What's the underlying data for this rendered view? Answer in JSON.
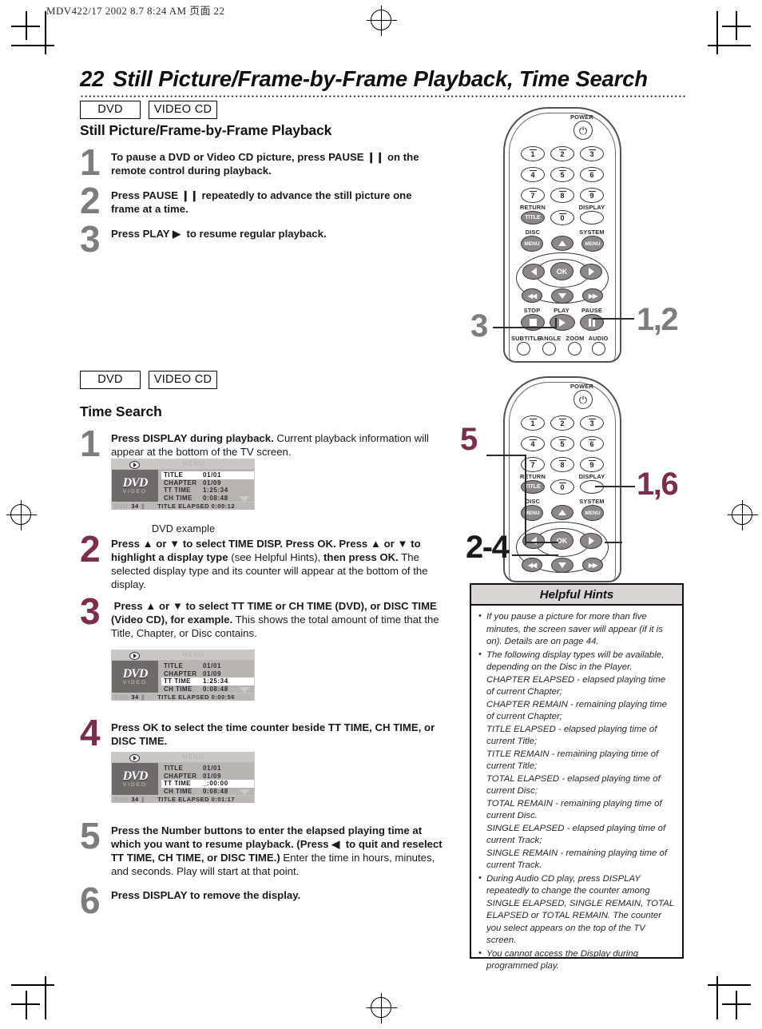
{
  "print_header": "MDV422/17  2002 8.7  8:24 AM  页面 22",
  "page": {
    "number": "22",
    "title": "Still Picture/Frame-by-Frame Playback, Time Search"
  },
  "section1": {
    "badges": [
      "DVD",
      "VIDEO CD"
    ],
    "heading": "Still Picture/Frame-by-Frame Playback",
    "steps": [
      {
        "n": "1",
        "color": "gray",
        "html": "<b>To pause a DVD or Video CD picture, press PAUSE ❙❙ on the remote control during playback.</b>"
      },
      {
        "n": "2",
        "color": "gray",
        "html": "<b>Press PAUSE ❙❙ repeatedly to advance the still picture one frame at a time.</b>"
      },
      {
        "n": "3",
        "color": "gray",
        "html": "<b>Press PLAY ▶ &nbsp;to resume regular playback.</b>"
      }
    ]
  },
  "section2": {
    "badges": [
      "DVD",
      "VIDEO CD"
    ],
    "heading": "Time Search",
    "steps": [
      {
        "n": "1",
        "color": "gray",
        "html": "<b>Press DISPLAY during playback.</b> Current playback information will appear at the bottom of the TV screen."
      },
      {
        "n": "2",
        "color": "maroon",
        "html": "<b>Press ▲ or ▼ to select TIME DISP. Press OK. Press ▲ or ▼ to highlight a display type</b> (see Helpful Hints), <b>then press OK.</b> The selected display type and its counter will appear at the bottom of the display."
      },
      {
        "n": "3",
        "color": "maroon",
        "html": "<b>&nbsp;Press ▲ or ▼ to select TT TIME or CH TIME (DVD), or DISC TIME (Video CD), for example.</b> This shows the total amount of time that the Title, Chapter, or Disc contains."
      },
      {
        "n": "4",
        "color": "maroon",
        "html": "<b>Press OK to select the time counter beside TT TIME, CH TIME, or DISC TIME.</b>"
      },
      {
        "n": "5",
        "color": "gray",
        "html": "<b>Press the Number buttons to enter the elapsed playing time at which you want to resume playback. (Press ◀ &nbsp;to quit and reselect TT TIME, CH TIME, or DISC TIME.)</b> Enter the time in hours, minutes, and seconds. Play will start at that point."
      },
      {
        "n": "6",
        "color": "gray",
        "html": "<b>Press DISPLAY to remove the display.</b>"
      }
    ],
    "osd_caption": "DVD example"
  },
  "osd_screens": [
    {
      "menu_word": "MENU",
      "logo_top": "DVD",
      "logo_bottom": "VIDEO",
      "rows": [
        {
          "label": "TITLE",
          "value": "01/01",
          "highlight": true
        },
        {
          "label": "CHAPTER",
          "value": "01/09",
          "highlight": false
        },
        {
          "label": "TT  TIME",
          "value": "1:25:34",
          "highlight": false
        },
        {
          "label": "CH  TIME",
          "value": "0:08:48",
          "highlight": false
        }
      ],
      "disc_label": "DVD",
      "page_num": "34",
      "counter_label": "TITLE  ELAPSED",
      "counter_value": "0:00:12"
    },
    {
      "menu_word": "MENU",
      "logo_top": "DVD",
      "logo_bottom": "VIDEO",
      "rows": [
        {
          "label": "TITLE",
          "value": "01/01",
          "highlight": false
        },
        {
          "label": "CHAPTER",
          "value": "01/09",
          "highlight": false
        },
        {
          "label": "TT  TIME",
          "value": "1:25:34",
          "highlight": true
        },
        {
          "label": "CH  TIME",
          "value": "0:08:48",
          "highlight": false
        }
      ],
      "disc_label": "DVD",
      "page_num": "34",
      "counter_label": "TITLE  ELAPSED",
      "counter_value": "0:00:56"
    },
    {
      "menu_word": "MENU",
      "logo_top": "DVD",
      "logo_bottom": "VIDEO",
      "rows": [
        {
          "label": "TITLE",
          "value": "01/01",
          "highlight": false
        },
        {
          "label": "CHAPTER",
          "value": "01/09",
          "highlight": false
        },
        {
          "label": "TT  TIME",
          "value": "_:00:00",
          "highlight": true
        },
        {
          "label": "CH  TIME",
          "value": "0:08:48",
          "highlight": false
        }
      ],
      "disc_label": "DVD",
      "page_num": "34",
      "counter_label": "TITLE  ELAPSED",
      "counter_value": "0:01:17"
    }
  ],
  "remote": {
    "power_label": "POWER",
    "power_glyph": "⏻",
    "numbers": [
      "1",
      "2",
      "3",
      "4",
      "5",
      "6",
      "7",
      "8",
      "9",
      "0"
    ],
    "return_label": "RETURN",
    "title_label": "TITLE",
    "display_label": "DISPLAY",
    "disc_label": "DISC",
    "system_label": "SYSTEM",
    "menu_label": "MENU",
    "ok_label": "OK",
    "stop_label": "STOP",
    "play_label": "PLAY",
    "pause_label": "PAUSE",
    "bottom_row": [
      "SUBTITLE",
      "ANGLE",
      "ZOOM",
      "AUDIO"
    ]
  },
  "callouts": {
    "remote1_left": "3",
    "remote1_right": "1,2",
    "remote2_left_top": "5",
    "remote2_left_bottom": "2-4",
    "remote2_right": "1,6"
  },
  "hints": {
    "title": "Helpful Hints",
    "items": [
      {
        "type": "bullet",
        "text": "If you pause a picture for more than five minutes, the screen saver will appear (if it is on). Details are on page 44."
      },
      {
        "type": "bullet",
        "text": "The following display types will be available, depending on the Disc in the Player."
      },
      {
        "type": "plain",
        "text": "CHAPTER ELAPSED - elapsed playing time of current Chapter;"
      },
      {
        "type": "plain",
        "text": "CHAPTER REMAIN - remaining playing time of current Chapter;"
      },
      {
        "type": "plain",
        "text": "TITLE ELAPSED - elapsed playing time of current Title;"
      },
      {
        "type": "plain",
        "text": "TITLE REMAIN - remaining playing time of current Title;"
      },
      {
        "type": "plain",
        "text": "TOTAL ELAPSED - elapsed playing time of current Disc;"
      },
      {
        "type": "plain",
        "text": "TOTAL REMAIN - remaining playing time of current Disc."
      },
      {
        "type": "plain",
        "text": "SINGLE ELAPSED - elapsed playing time of current Track;"
      },
      {
        "type": "plain",
        "text": "SINGLE REMAIN - remaining playing time of current Track."
      },
      {
        "type": "bullet",
        "text": "During Audio CD play, press DISPLAY repeatedly to change the counter among SINGLE ELAPSED, SINGLE REMAIN, TOTAL ELAPSED or TOTAL REMAIN. The counter you select appears on the top of the TV screen."
      },
      {
        "type": "bullet",
        "text": "You cannot access the Display during programmed play."
      }
    ]
  },
  "colors": {
    "maroon": "#7b2d4e",
    "gray": "#7d7d7d"
  }
}
